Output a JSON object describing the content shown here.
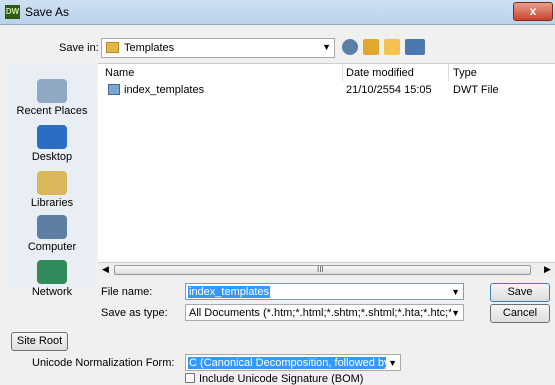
{
  "window": {
    "title": "Save As",
    "app_icon": "DW",
    "close": "x"
  },
  "toolbar": {
    "save_in_label": "Save in:",
    "save_in_value": "Templates"
  },
  "places": [
    "Recent Places",
    "Desktop",
    "Libraries",
    "Computer",
    "Network"
  ],
  "columns": [
    "Name",
    "Date modified",
    "Type"
  ],
  "files": [
    {
      "name": "index_templates",
      "date": "21/10/2554 15:05",
      "type": "DWT File"
    }
  ],
  "scroll_grip": "III",
  "form": {
    "file_name_label": "File name:",
    "file_name_value": "index_templates",
    "save_as_type_label": "Save as type:",
    "save_as_type_value": "All Documents (*.htm;*.html;*.shtm;*.shtml;*.hta;*.htc;*.xhtml;*.",
    "save_button": "Save",
    "cancel_button": "Cancel"
  },
  "extras": {
    "site_root_button": "Site Root",
    "unicode_label": "Unicode Normalization Form:",
    "unicode_value": "C (Canonical Decomposition, followed by Canc",
    "bom_label": "Include Unicode Signature (BOM)"
  },
  "colors": {
    "selection": "#3399ff",
    "close_red": "#c7432b"
  }
}
